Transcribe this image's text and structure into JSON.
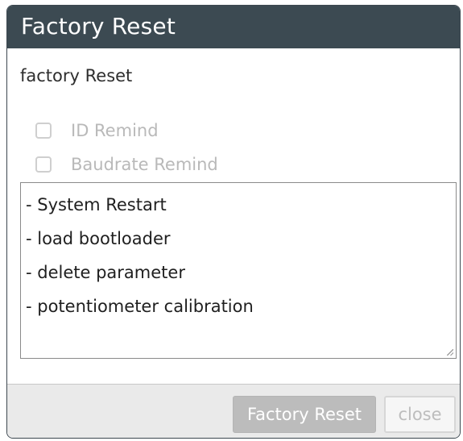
{
  "window": {
    "title": "Factory Reset"
  },
  "content": {
    "heading": "factory Reset",
    "options": [
      {
        "label": "ID Remind",
        "checked": false,
        "enabled": false
      },
      {
        "label": "Baudrate Remind",
        "checked": false,
        "enabled": false
      }
    ],
    "log_lines": [
      "- System Restart",
      "- load bootloader",
      "- delete parameter",
      "- potentiometer calibration"
    ]
  },
  "footer": {
    "reset_label": "Factory Reset",
    "close_label": "close"
  },
  "colors": {
    "titlebar": "#3c4a52",
    "title_text": "#ffffff",
    "disabled_text": "#b9b9b9",
    "footer_bg": "#eaeaea"
  }
}
